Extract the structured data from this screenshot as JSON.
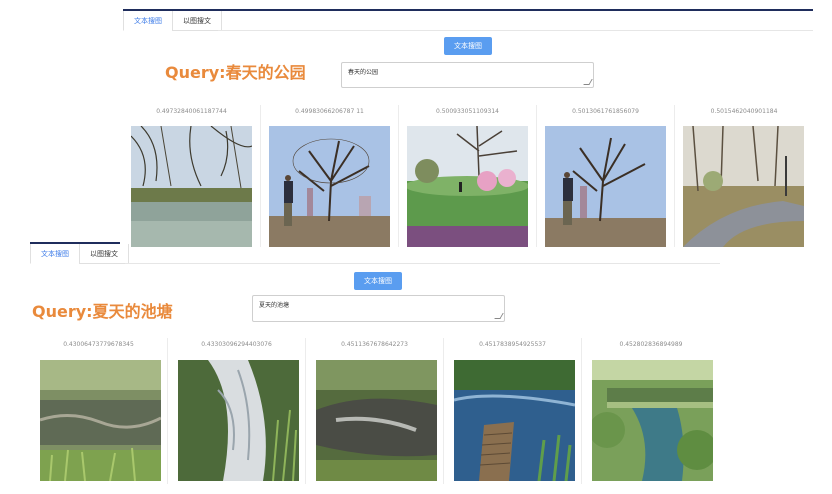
{
  "panel1": {
    "tabs": [
      {
        "label": "文本搜图",
        "active": true
      },
      {
        "label": "以图搜文",
        "active": false
      }
    ],
    "search_button": "文本搜图",
    "query_label": "Query:春天的公园",
    "query_text": "春天的公园",
    "results": [
      {
        "score": "0.49732840061187744",
        "icon": "willow-pond-image"
      },
      {
        "score": "0.49983066206787 11",
        "icon": "golfer-tree-image"
      },
      {
        "score": "0.500933051109314",
        "icon": "park-lawn-blossom-image"
      },
      {
        "score": "0.5013061761856079",
        "icon": "golfer-tree-image"
      },
      {
        "score": "0.5015462040901184",
        "icon": "park-path-image"
      }
    ]
  },
  "panel2": {
    "tabs": [
      {
        "label": "文本搜图",
        "active": true
      },
      {
        "label": "以图搜文",
        "active": false
      }
    ],
    "search_button": "文本搜图",
    "query_label": "Query:夏天的池塘",
    "query_text": "夏天的池塘",
    "results": [
      {
        "score": "0.43006473779678345",
        "icon": "marsh-pond-image"
      },
      {
        "score": "0.43303096294403076",
        "icon": "waterfall-stream-image"
      },
      {
        "score": "0.4511367678642273",
        "icon": "overgrown-stream-image"
      },
      {
        "score": "0.4517838954925537",
        "icon": "blue-pond-dock-image"
      },
      {
        "score": "0.452802836894989",
        "icon": "mossy-bridge-image"
      }
    ]
  }
}
